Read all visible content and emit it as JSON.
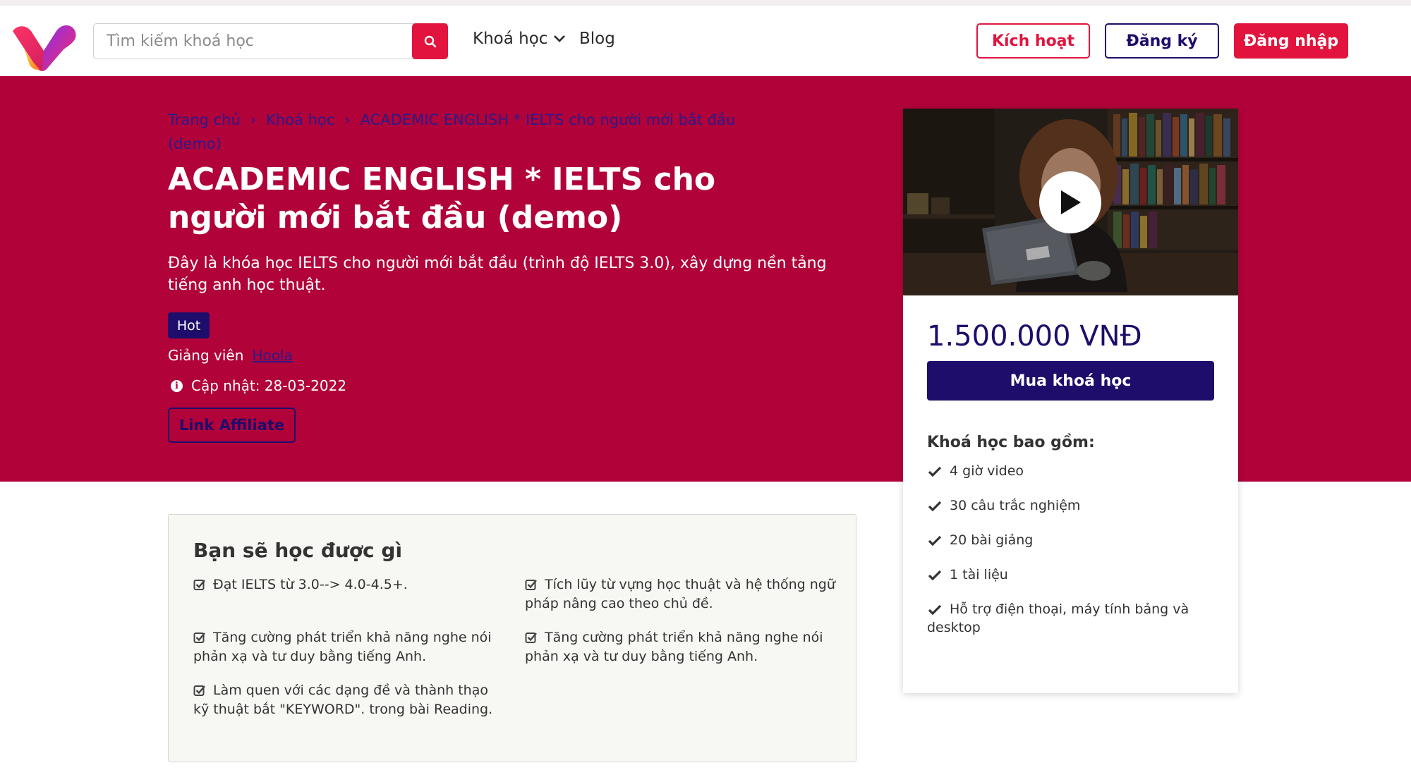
{
  "header": {
    "search_placeholder": "Tìm kiếm khoá học",
    "nav": {
      "courses": "Khoá học",
      "blog": "Blog"
    },
    "activate": "Kích hoạt",
    "register": "Đăng ký",
    "login": "Đăng nhập"
  },
  "breadcrumb": {
    "home": "Trang chủ",
    "courses": "Khoá học",
    "current": "ACADEMIC ENGLISH * IELTS cho người mới bắt đầu (demo)"
  },
  "course": {
    "title": "ACADEMIC ENGLISH * IELTS cho người mới bắt đầu (demo)",
    "description": "Đây là khóa học IELTS cho người mới bắt đầu (trình độ IELTS 3.0), xây dựng nền tảng tiếng anh học thuật.",
    "badge": "Hot",
    "instructor_label": "Giảng viên",
    "instructor_name": "Hoola",
    "updated": "Cập nhật: 28-03-2022",
    "affiliate": "Link Affiliate"
  },
  "card": {
    "price": "1.500.000 VNĐ",
    "buy": "Mua khoá học",
    "includes_title": "Khoá học bao gồm:",
    "includes": [
      "4 giờ video",
      "30 câu trắc nghiệm",
      "20 bài giảng",
      "1 tài liệu",
      "Hỗ trợ điện thoại, máy tính bảng và desktop"
    ]
  },
  "learn": {
    "title": "Bạn sẽ học được gì",
    "items": [
      "Đạt IELTS từ 3.0--> 4.0-4.5+.",
      "Tích lũy từ vựng học thuật và hệ thống ngữ pháp nâng cao theo chủ đề.",
      "Tăng cường phát triển khả năng nghe nói phản xạ và tư duy bằng tiếng Anh.",
      "Tăng cường phát triển khả năng nghe nói phản xạ và tư duy bằng tiếng Anh.",
      "Làm quen với các dạng đề và thành thạo kỹ thuật bắt \"KEYWORD\". trong bài Reading."
    ]
  },
  "icons": {
    "logo": "v-logo-icon",
    "search": "search-icon",
    "chevron": "chevron-down-icon",
    "info": "info-icon",
    "play": "play-icon",
    "check": "check-icon",
    "checkbox": "checkbox-icon"
  },
  "colors": {
    "brand_red": "#e2143d",
    "hero_bg": "#b10239",
    "navy": "#1e0d6b",
    "learn_bg": "#f7f7f3"
  }
}
